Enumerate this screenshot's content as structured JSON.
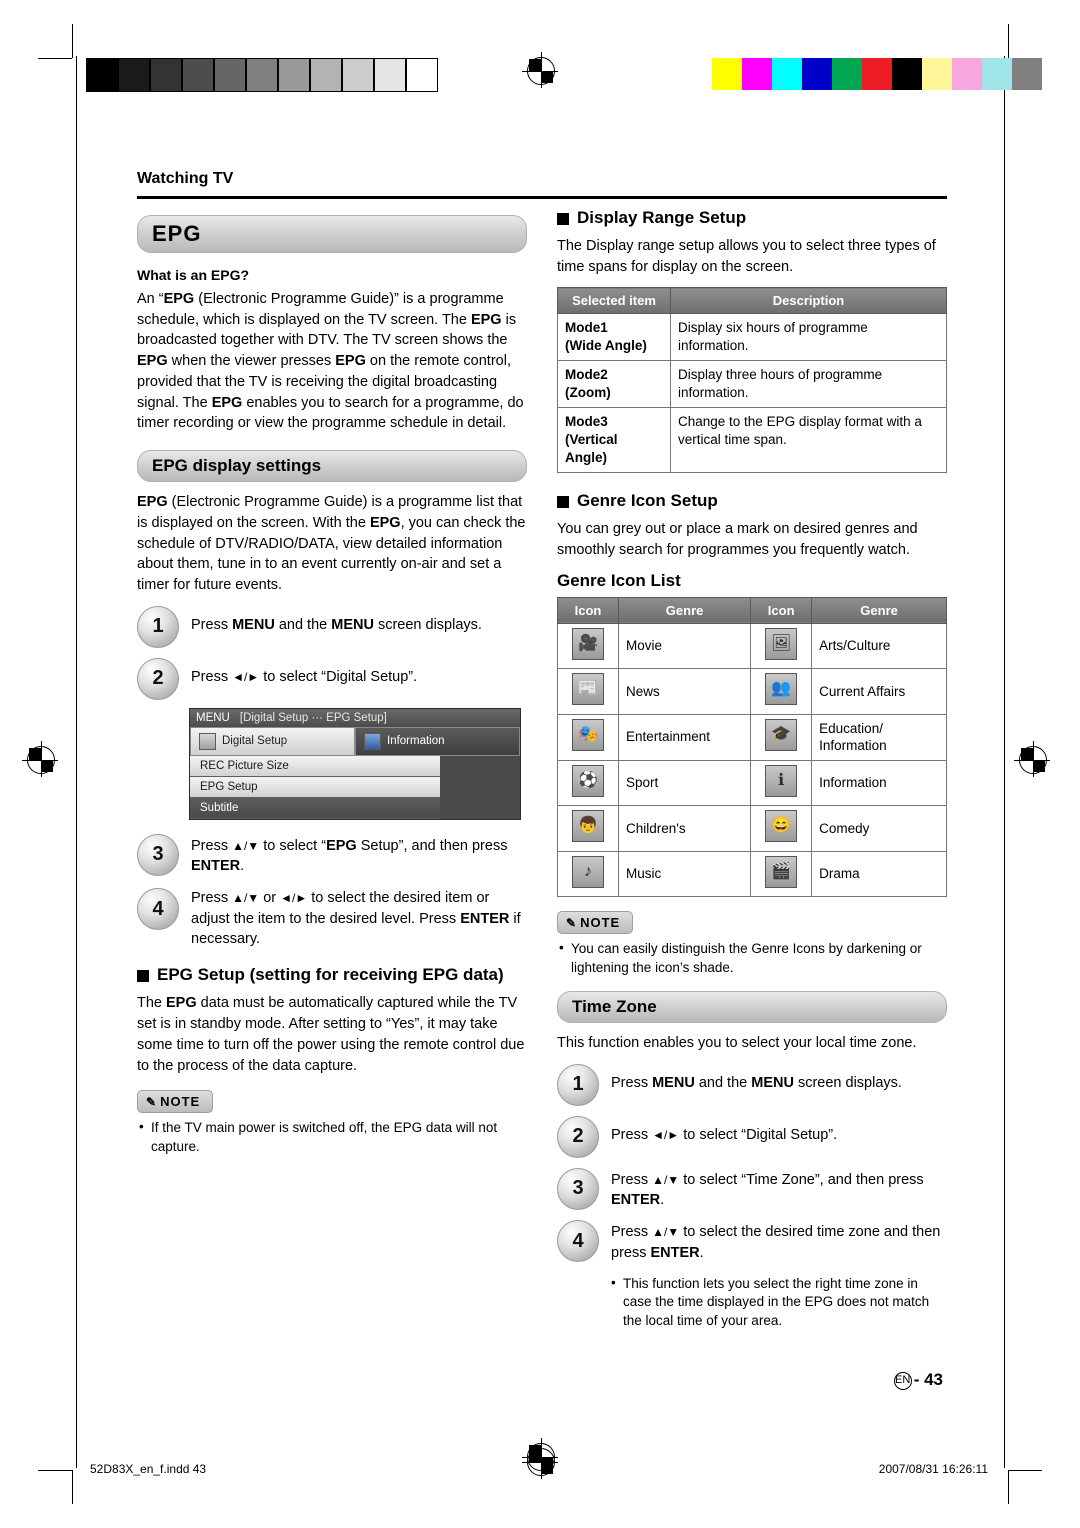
{
  "header": {
    "breadcrumb": "Watching TV"
  },
  "left": {
    "epg_title": "EPG",
    "what_is_heading": "What is an EPG?",
    "what_is_body": "An “EPG (Electronic Programme Guide)” is a programme schedule, which is displayed on the TV screen. The EPG is broadcasted together with DTV. The TV screen shows the EPG when the viewer presses EPG on the remote control, provided that the TV is receiving the digital broadcasting signal. The EPG enables you to search for a programme, do timer recording or view the programme schedule in detail.",
    "display_settings_title": "EPG display settings",
    "display_settings_body": "EPG (Electronic Programme Guide) is a programme list that is displayed on the screen. With the EPG, you can check the schedule of DTV/RADIO/DATA, view detailed information about them, tune in to an event currently on-air and set a timer for future events.",
    "steps": [
      {
        "num": "1",
        "text": "Press MENU and the MENU screen displays."
      },
      {
        "num": "2",
        "text": "Press ◄/► to select “Digital Setup”."
      },
      {
        "num": "3",
        "text": "Press ▲/▼ to select “EPG Setup”, and then press ENTER."
      },
      {
        "num": "4",
        "text": "Press ▲/▼ or ◄/► to select the desired item or adjust the item to the desired level. Press ENTER if necessary."
      }
    ],
    "osd": {
      "menu_label": "MENU",
      "crumb": "[Digital Setup ··· EPG Setup]",
      "tab1": "Digital Setup",
      "tab2": "Information",
      "rows": [
        "REC Picture Size",
        "EPG Setup",
        "Subtitle"
      ]
    },
    "epg_setup_heading": "EPG Setup (setting for receiving EPG data)",
    "epg_setup_body": "The EPG data must be automatically captured while the TV set is in standby mode. After setting to “Yes”, it may take some time to turn off the power using the remote control due to the process of the data capture.",
    "note_label": "NOTE",
    "note_items": [
      "If the TV main power is switched off, the EPG data will not capture."
    ]
  },
  "right": {
    "display_range_heading": "Display Range Setup",
    "display_range_body": "The Display range setup allows you to select three types of time spans for display on the screen.",
    "range_table": {
      "headers": [
        "Selected item",
        "Description"
      ],
      "rows": [
        {
          "item": "Mode1\n(Wide Angle)",
          "item_line1": "Mode1",
          "item_line2": "(Wide Angle)",
          "desc": "Display six hours of programme information."
        },
        {
          "item": "Mode2\n(Zoom)",
          "item_line1": "Mode2",
          "item_line2": "(Zoom)",
          "desc": "Display three hours of programme information."
        },
        {
          "item": "Mode3\n(Vertical Angle)",
          "item_line1": "Mode3",
          "item_line2": "(Vertical",
          "item_line3": "Angle)",
          "desc": "Change to the EPG display format with a vertical time span."
        }
      ]
    },
    "genre_icon_heading": "Genre Icon Setup",
    "genre_icon_body": "You can grey out or place a mark on desired genres and smoothly search for programmes you frequently watch.",
    "genre_list_title": "Genre Icon List",
    "genre_table": {
      "headers": [
        "Icon",
        "Genre",
        "Icon",
        "Genre"
      ],
      "rows": [
        {
          "left_icon": "movie-icon",
          "left_glyph": "🎥",
          "left": "Movie",
          "right_icon": "arts-culture-icon",
          "right_glyph": "🖼",
          "right": "Arts/Culture"
        },
        {
          "left_icon": "news-icon",
          "left_glyph": "📰",
          "left": "News",
          "right_icon": "current-affairs-icon",
          "right_glyph": "👥",
          "right": "Current Affairs"
        },
        {
          "left_icon": "entertainment-icon",
          "left_glyph": "🎭",
          "left": "Entertainment",
          "right_icon": "education-information-icon",
          "right_glyph": "🎓",
          "right": "Education/\nInformation"
        },
        {
          "left_icon": "sport-icon",
          "left_glyph": "⚽",
          "left": "Sport",
          "right_icon": "information-icon",
          "right_glyph": "ℹ",
          "right": "Information"
        },
        {
          "left_icon": "childrens-icon",
          "left_glyph": "👦",
          "left": "Children's",
          "right_icon": "comedy-icon",
          "right_glyph": "😄",
          "right": "Comedy"
        },
        {
          "left_icon": "music-icon",
          "left_glyph": "♪",
          "left": "Music",
          "right_icon": "drama-icon",
          "right_glyph": "🎬",
          "right": "Drama"
        }
      ]
    },
    "note_label": "NOTE",
    "note_items": [
      "You can easily distinguish the Genre Icons by darkening or lightening the icon’s shade."
    ],
    "time_zone_title": "Time Zone",
    "time_zone_body": "This function enables you to select your local time zone.",
    "time_zone_steps": [
      {
        "num": "1",
        "text": "Press MENU and the MENU screen displays."
      },
      {
        "num": "2",
        "text": "Press ◄/► to select “Digital Setup”."
      },
      {
        "num": "3",
        "text": "Press ▲/▼ to select “Time Zone”, and then press ENTER."
      },
      {
        "num": "4",
        "text": "Press ▲/▼ to select the desired time zone and then press ENTER."
      }
    ],
    "time_zone_notes": [
      "This function lets you select the right time zone in case the time displayed in the EPG does not match the local time of your area."
    ]
  },
  "footer": {
    "page_marker": "EN",
    "page_number": "43",
    "file_name": "52D83X_en_f.indd   43",
    "timestamp": "2007/08/31   16:26:11"
  },
  "marks": {
    "grayscale": [
      "#000000",
      "#1a1a1a",
      "#333333",
      "#4d4d4d",
      "#666666",
      "#808080",
      "#999999",
      "#b3b3b3",
      "#cccccc",
      "#e6e6e6",
      "#ffffff"
    ],
    "colors": [
      "#ffff00",
      "#ff00ff",
      "#00ffff",
      "#0000c8",
      "#00a651",
      "#ed1c24",
      "#000000",
      "#fff799",
      "#f9a7e0",
      "#9fe5e8",
      "#808080"
    ]
  }
}
